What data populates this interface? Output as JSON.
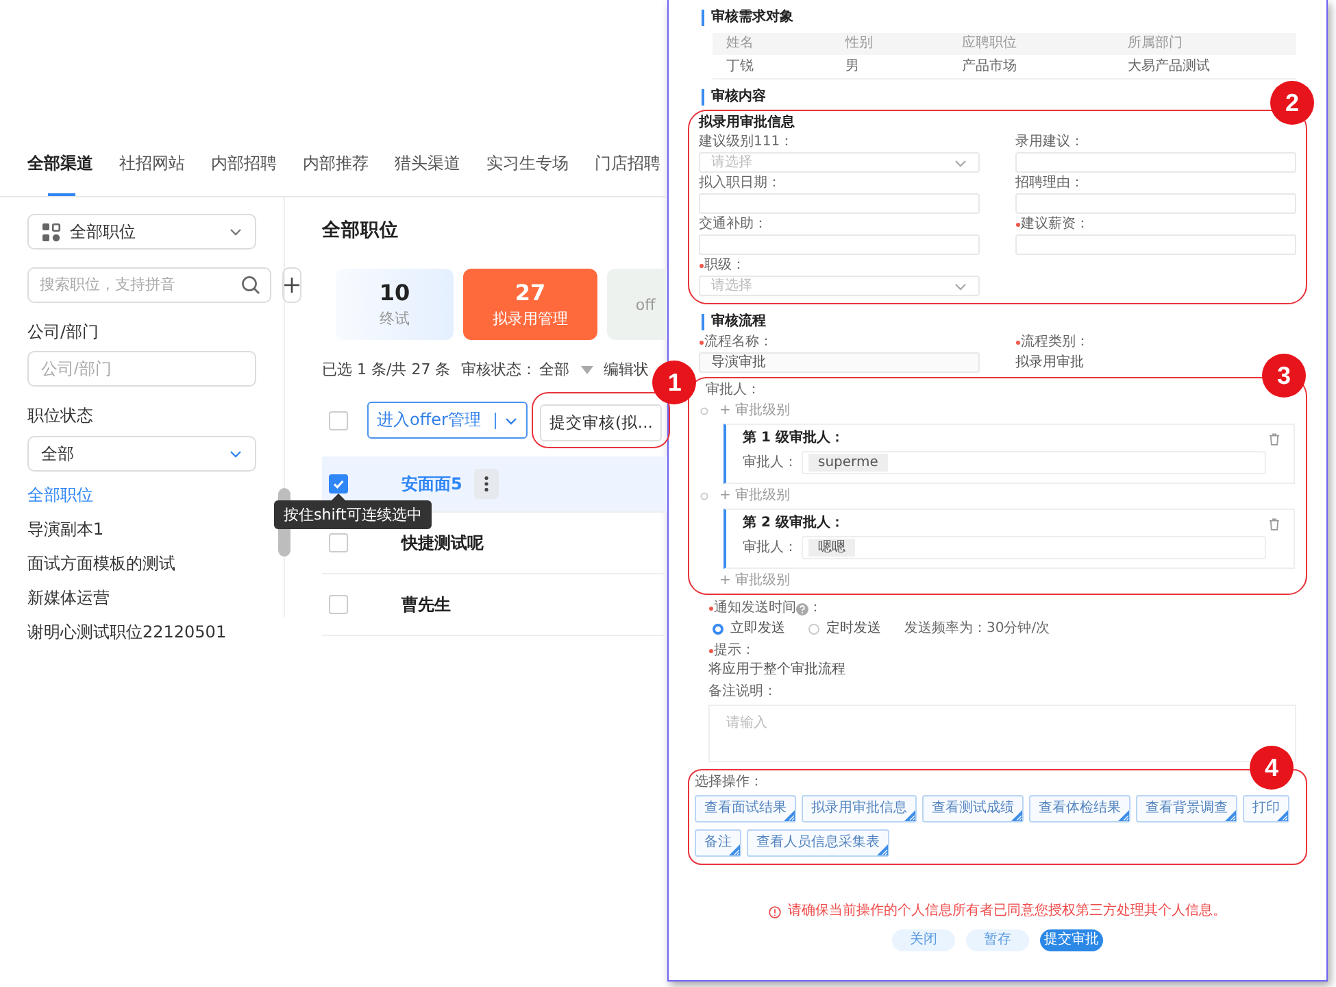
{
  "channel_tabs": [
    {
      "label": "全部渠道",
      "selected": true
    },
    {
      "label": "社招网站",
      "selected": false
    },
    {
      "label": "内部招聘",
      "selected": false
    },
    {
      "label": "内部推荐",
      "selected": false
    },
    {
      "label": "猎头渠道",
      "selected": false
    },
    {
      "label": "实习生专场",
      "selected": false
    },
    {
      "label": "门店招聘",
      "selected": false
    }
  ],
  "sidebar": {
    "position_select": {
      "value": "全部职位"
    },
    "search": {
      "placeholder": "搜索职位，支持拼音"
    },
    "company": {
      "label": "公司/部门",
      "placeholder": "公司/部门"
    },
    "status": {
      "label": "职位状态",
      "value": "全部"
    },
    "positions": [
      {
        "label": "全部职位",
        "selected": true
      },
      {
        "label": "导演副本1",
        "selected": false
      },
      {
        "label": "面试方面模板的测试",
        "selected": false
      },
      {
        "label": "新媒体运营",
        "selected": false
      },
      {
        "label": "谢明心测试职位22120501",
        "selected": false
      }
    ]
  },
  "main": {
    "title": "全部职位",
    "stages": [
      {
        "count": "10",
        "label": "终试",
        "selected": false
      },
      {
        "count": "27",
        "label": "拟录用管理",
        "selected": true
      },
      {
        "label": "off",
        "selected": false
      }
    ],
    "summary": "已选 1 条/共 27 条",
    "filter": {
      "label": "审核状态：",
      "value": "全部"
    },
    "filter_2": "编辑状",
    "toolbar": {
      "all_checked": false,
      "offer_button": "进入offer管理",
      "submit_button": "提交审核(拟..."
    },
    "rows": [
      {
        "name": "安面面5",
        "checked": true,
        "selected": true
      },
      {
        "name": "快捷测试呢",
        "checked": false,
        "selected": false
      },
      {
        "name": "曹先生",
        "checked": false,
        "selected": false
      }
    ],
    "tooltip": "按住shift可连续选中"
  },
  "review": {
    "target": {
      "title": "审核需求对象",
      "columns": [
        "姓名",
        "性别",
        "应聘职位",
        "所属部门"
      ],
      "rows": [
        [
          "丁锐",
          "男",
          "产品市场",
          "大易产品测试"
        ]
      ]
    },
    "content": {
      "title": "审核内容",
      "subtitle": "拟录用审批信息",
      "fields": [
        {
          "label": "建议级别111：",
          "kind": "select",
          "placeholder": "请选择",
          "required": false
        },
        {
          "label": "录用建议：",
          "kind": "input",
          "required": false
        },
        {
          "label": "拟入职日期：",
          "kind": "input",
          "required": false
        },
        {
          "label": "招聘理由：",
          "kind": "input",
          "required": false
        },
        {
          "label": "交通补助：",
          "kind": "input",
          "required": false
        },
        {
          "label": "建议薪资：",
          "kind": "input",
          "required": true
        },
        {
          "label": "职级：",
          "kind": "select",
          "placeholder": "请选择",
          "required": true
        }
      ]
    },
    "flow": {
      "title": "审核流程",
      "name": {
        "label": "流程名称：",
        "required": true,
        "value": "导演审批"
      },
      "type": {
        "label": "流程类别：",
        "required": true,
        "value": "拟录用审批"
      },
      "approvers_label": "审批人：",
      "steps": [
        {
          "kind": "add",
          "label": "+ 审批级别"
        },
        {
          "kind": "level",
          "title": "第 1 级审批人：",
          "approver_label": "审批人：",
          "approver": "superme"
        },
        {
          "kind": "add",
          "label": "+ 审批级别"
        },
        {
          "kind": "level",
          "title": "第 2 级审批人：",
          "approver_label": "审批人：",
          "approver": "嗯嗯"
        },
        {
          "kind": "add_end",
          "label": "+ 审批级别"
        }
      ]
    },
    "notify": {
      "label": "通知发送时间",
      "suffix": "：",
      "required": true,
      "options": [
        {
          "label": "立即发送",
          "selected": true
        },
        {
          "label": "定时发送",
          "selected": false
        }
      ],
      "frequency": "发送频率为：30分钟/次"
    },
    "hint": {
      "label": "提示：",
      "required": true,
      "text": "将应用于整个审批流程"
    },
    "remark": {
      "label": "备注说明：",
      "placeholder": "请输入"
    },
    "actions": {
      "label": "选择操作：",
      "buttons": [
        "查看面试结果",
        "拟录用审批信息",
        "查看测试成绩",
        "查看体检结果",
        "查看背景调查",
        "打印",
        "备注",
        "查看人员信息采集表"
      ]
    },
    "warning": "请确保当前操作的个人信息所有者已同意您授权第三方处理其个人信息。",
    "footer": [
      {
        "label": "关闭",
        "kind": "secondary"
      },
      {
        "label": "暂存",
        "kind": "secondary"
      },
      {
        "label": "提交审批",
        "kind": "primary"
      }
    ]
  },
  "annotations": [
    "1",
    "2",
    "3",
    "4"
  ]
}
